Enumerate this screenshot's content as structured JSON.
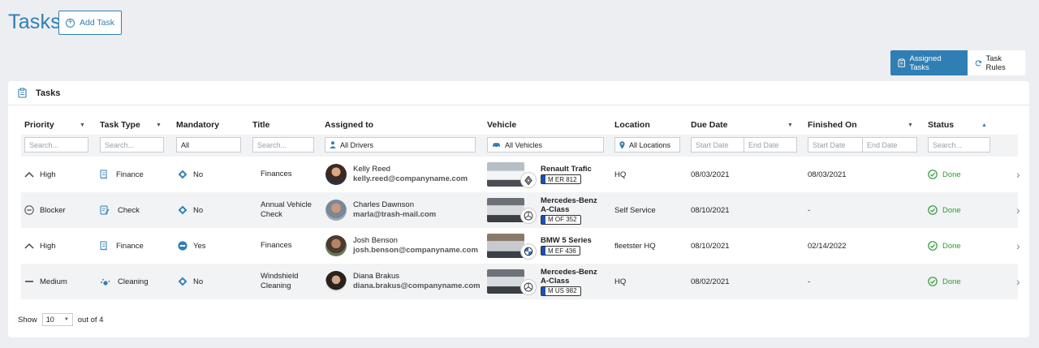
{
  "page": {
    "title": "Tasks",
    "add_task_label": "Add Task"
  },
  "view_toggle": {
    "assigned_label": "Assigned Tasks",
    "rules_label": "Task Rules"
  },
  "card": {
    "title": "Tasks"
  },
  "columns": [
    "Priority",
    "Task Type",
    "Mandatory",
    "Title",
    "Assigned to",
    "Vehicle",
    "Location",
    "Due Date",
    "Finished On",
    "Status"
  ],
  "filters": {
    "priority_placeholder": "Search...",
    "type_placeholder": "Search...",
    "mandatory_value": "All",
    "title_placeholder": "Search...",
    "drivers_value": "All Drivers",
    "vehicles_value": "All Vehicles",
    "locations_value": "All Locations",
    "due_start": "Start Date",
    "due_end": "End Date",
    "finished_start": "Start Date",
    "finished_end": "End Date",
    "status_placeholder": "Search..."
  },
  "rows": [
    {
      "priority": "High",
      "priority_icon": "chevron-up-icon",
      "type": "Finance",
      "type_icon": "receipt-icon",
      "mandatory": "No",
      "mandatory_icon": "diamond-icon",
      "title": "Finances",
      "name": "Kelly Reed",
      "email": "kelly.reed@companyname.com",
      "vehicle": "Renault Trafic",
      "plate": "M ER 812",
      "brand_icon": "renault-logo-icon",
      "location": "HQ",
      "due": "08/03/2021",
      "finished": "08/03/2021",
      "status": "Done"
    },
    {
      "priority": "Blocker",
      "priority_icon": "minus-circle-icon",
      "type": "Check",
      "type_icon": "checklist-icon",
      "mandatory": "No",
      "mandatory_icon": "diamond-icon",
      "title": "Annual Vehicle Check",
      "name": "Charles Dawnson",
      "email": "marla@trash-mail.com",
      "vehicle": "Mercedes-Benz A-Class",
      "plate": "M OF 352",
      "brand_icon": "mercedes-logo-icon",
      "location": "Self Service",
      "due": "08/10/2021",
      "finished": "-",
      "status": "Done"
    },
    {
      "priority": "High",
      "priority_icon": "chevron-up-icon",
      "type": "Finance",
      "type_icon": "receipt-icon",
      "mandatory": "Yes",
      "mandatory_icon": "no-entry-icon",
      "title": "Finances",
      "name": "Josh Benson",
      "email": "josh.benson@companyname.com",
      "vehicle": "BMW 5 Series",
      "plate": "M EF 436",
      "brand_icon": "bmw-logo-icon",
      "location": "fleetster HQ",
      "due": "08/10/2021",
      "finished": "02/14/2022",
      "status": "Done"
    },
    {
      "priority": "Medium",
      "priority_icon": "dash-icon",
      "type": "Cleaning",
      "type_icon": "cleaning-icon",
      "mandatory": "No",
      "mandatory_icon": "diamond-icon",
      "title": "Windshield Cleaning",
      "name": "Diana Brakus",
      "email": "diana.brakus@companyname.com",
      "vehicle": "Mercedes-Benz A-Class",
      "plate": "M US 982",
      "brand_icon": "mercedes-logo-icon",
      "location": "HQ",
      "due": "08/02/2021",
      "finished": "-",
      "status": "Done"
    }
  ],
  "footer": {
    "show_label": "Show",
    "page_size": "10",
    "count_label": "out of 4"
  },
  "colors": {
    "accent": "#2f7fb5",
    "done": "#2d9a36",
    "background": "#eceef1"
  }
}
